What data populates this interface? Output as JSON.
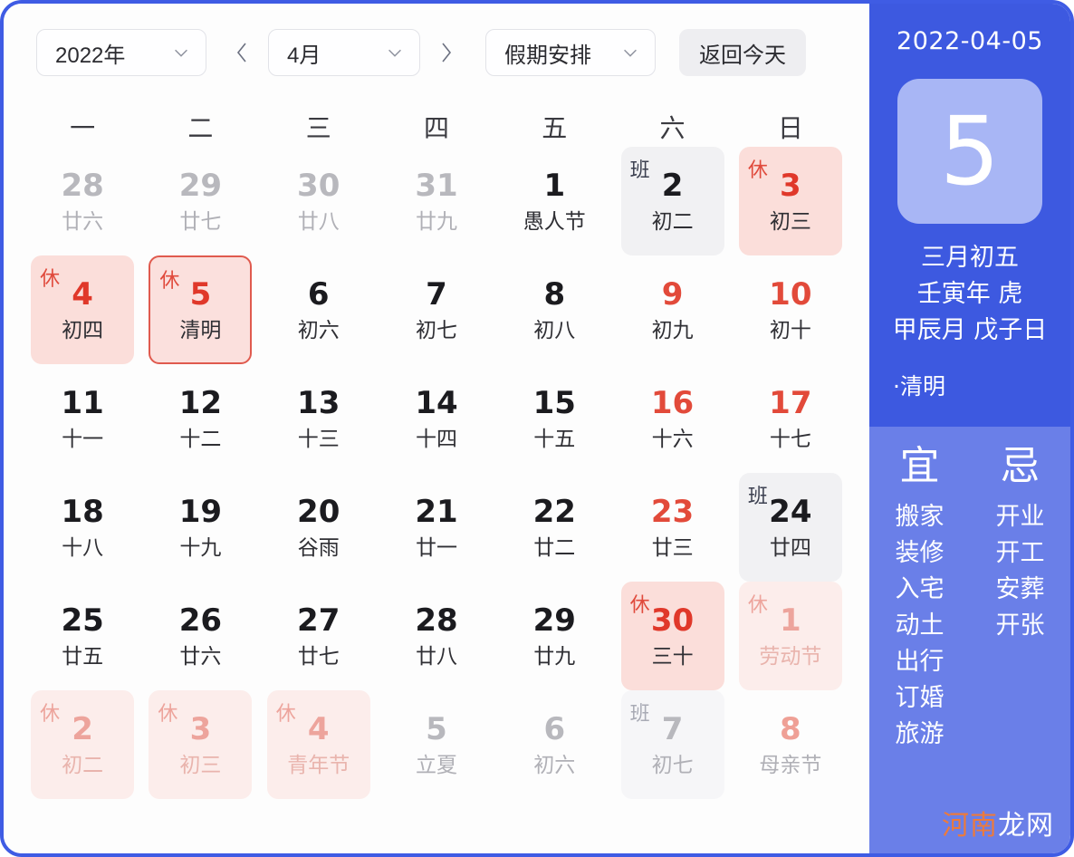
{
  "toolbar": {
    "year_label": "2022年",
    "month_label": "4月",
    "holiday_label": "假期安排",
    "today_label": "返回今天",
    "prev_icon": "chevron-left-icon",
    "next_icon": "chevron-right-icon",
    "dropdown_icon": "chevron-down-icon"
  },
  "weekdays": [
    "一",
    "二",
    "三",
    "四",
    "五",
    "六",
    "日"
  ],
  "colors": {
    "frame_border": "#3f5ce4",
    "panel_top": "#3d59e0",
    "panel_bottom": "#6a7fe8",
    "bigday_box": "#a8b6f5",
    "rest_bg": "#fbdeda",
    "work_bg": "#f1f1f3",
    "selected_border": "#e05a4e",
    "rest_text": "#e0382a",
    "weekend_text": "#e24a3a"
  },
  "days": [
    {
      "num": "28",
      "lunar": "廿六",
      "other": true
    },
    {
      "num": "29",
      "lunar": "廿七",
      "other": true
    },
    {
      "num": "30",
      "lunar": "廿八",
      "other": true
    },
    {
      "num": "31",
      "lunar": "廿九",
      "other": true
    },
    {
      "num": "1",
      "lunar": "愚人节"
    },
    {
      "num": "2",
      "lunar": "初二",
      "badge": "班",
      "type": "work"
    },
    {
      "num": "3",
      "lunar": "初三",
      "badge": "休",
      "type": "rest"
    },
    {
      "num": "4",
      "lunar": "初四",
      "badge": "休",
      "type": "rest"
    },
    {
      "num": "5",
      "lunar": "清明",
      "badge": "休",
      "type": "rest",
      "selected": true
    },
    {
      "num": "6",
      "lunar": "初六"
    },
    {
      "num": "7",
      "lunar": "初七"
    },
    {
      "num": "8",
      "lunar": "初八"
    },
    {
      "num": "9",
      "lunar": "初九",
      "weekend": true
    },
    {
      "num": "10",
      "lunar": "初十",
      "weekend": true
    },
    {
      "num": "11",
      "lunar": "十一"
    },
    {
      "num": "12",
      "lunar": "十二"
    },
    {
      "num": "13",
      "lunar": "十三"
    },
    {
      "num": "14",
      "lunar": "十四"
    },
    {
      "num": "15",
      "lunar": "十五"
    },
    {
      "num": "16",
      "lunar": "十六",
      "weekend": true
    },
    {
      "num": "17",
      "lunar": "十七",
      "weekend": true
    },
    {
      "num": "18",
      "lunar": "十八"
    },
    {
      "num": "19",
      "lunar": "十九"
    },
    {
      "num": "20",
      "lunar": "谷雨"
    },
    {
      "num": "21",
      "lunar": "廿一"
    },
    {
      "num": "22",
      "lunar": "廿二"
    },
    {
      "num": "23",
      "lunar": "廿三",
      "weekend": true
    },
    {
      "num": "24",
      "lunar": "廿四",
      "badge": "班",
      "type": "work"
    },
    {
      "num": "25",
      "lunar": "廿五"
    },
    {
      "num": "26",
      "lunar": "廿六"
    },
    {
      "num": "27",
      "lunar": "廿七"
    },
    {
      "num": "28",
      "lunar": "廿八"
    },
    {
      "num": "29",
      "lunar": "廿九"
    },
    {
      "num": "30",
      "lunar": "三十",
      "badge": "休",
      "type": "rest"
    },
    {
      "num": "1",
      "lunar": "劳动节",
      "badge": "休",
      "type": "rest",
      "other": true
    },
    {
      "num": "2",
      "lunar": "初二",
      "badge": "休",
      "type": "rest",
      "other": true
    },
    {
      "num": "3",
      "lunar": "初三",
      "badge": "休",
      "type": "rest",
      "other": true
    },
    {
      "num": "4",
      "lunar": "青年节",
      "badge": "休",
      "type": "rest",
      "other": true
    },
    {
      "num": "5",
      "lunar": "立夏",
      "other": true
    },
    {
      "num": "6",
      "lunar": "初六",
      "other": true
    },
    {
      "num": "7",
      "lunar": "初七",
      "badge": "班",
      "type": "work",
      "other": true
    },
    {
      "num": "8",
      "lunar": "母亲节",
      "other": true,
      "weekend": true
    }
  ],
  "panel": {
    "date": "2022-04-05",
    "day_number": "5",
    "lunar_day": "三月初五",
    "ganzhi_year": "壬寅年 虎",
    "ganzhi_month_day": "甲辰月 戊子日",
    "solar_term": "·清明",
    "yi_title": "宜",
    "ji_title": "忌",
    "yi_items": [
      "搬家",
      "装修",
      "入宅",
      "动土",
      "出行",
      "订婚",
      "旅游"
    ],
    "ji_items": [
      "开业",
      "开工",
      "安葬",
      "开张"
    ],
    "watermark_a": "河南",
    "watermark_b": "龙网"
  }
}
